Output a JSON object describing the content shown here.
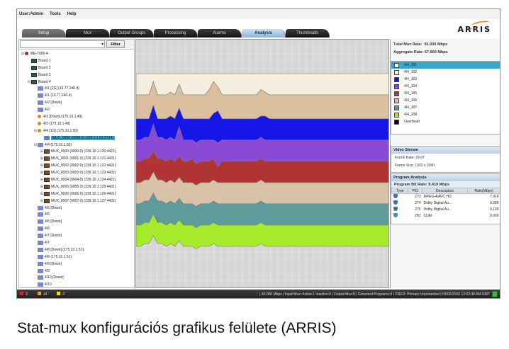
{
  "menu": [
    "User:Admin",
    "Tools",
    "Help"
  ],
  "tabs": [
    "Setup",
    "Mux",
    "Output Groups",
    "Processing",
    "Alarms",
    "Analysis",
    "Thumbnails"
  ],
  "active_tab": "Analysis",
  "logo_text": "ARRIS",
  "filter": {
    "combo_value": "",
    "button_label": "Filter"
  },
  "tree": [
    {
      "indent": 0,
      "exp": "⊟",
      "icon": "dev",
      "text": "ME-7000-4"
    },
    {
      "indent": 1,
      "exp": "",
      "icon": "board",
      "text": "Board 1"
    },
    {
      "indent": 1,
      "exp": "",
      "icon": "board",
      "text": "Board 2"
    },
    {
      "indent": 1,
      "exp": "",
      "icon": "board",
      "text": "Board 3"
    },
    {
      "indent": 1,
      "exp": "⊟",
      "icon": "board",
      "text": "Board 4"
    },
    {
      "indent": 2,
      "exp": "",
      "icon": "out",
      "text": "4/1 [1G] (10.77.240.4)"
    },
    {
      "indent": 2,
      "exp": "",
      "icon": "out",
      "text": "4/1 (10.77.240.4)"
    },
    {
      "indent": 2,
      "exp": "",
      "icon": "out",
      "text": "4/2 [Down]"
    },
    {
      "indent": 2,
      "exp": "",
      "icon": "out",
      "text": "4/2"
    },
    {
      "indent": 2,
      "exp": "",
      "icon": "warn",
      "text": "4/3 [Down] (175.10.1.49)"
    },
    {
      "indent": 2,
      "exp": "",
      "icon": "warn",
      "text": "4/3 (175.10.1.49)"
    },
    {
      "indent": 2,
      "exp": "⊟",
      "icon": "warn",
      "text": "4/4 [1G] (175.10.1.50)"
    },
    {
      "indent": 3,
      "exp": "",
      "icon": "mux",
      "text": "MUX_0000 (0000:0) (239.2.1.91:5724)",
      "selected": true
    },
    {
      "indent": 2,
      "exp": "⊟",
      "icon": "out",
      "text": "4/4 (175.10.1.50)"
    },
    {
      "indent": 3,
      "exp": "⊞",
      "icon": "prog",
      "text": "MUX_0000 (0000:0) (239.10.1.120:4421)"
    },
    {
      "indent": 3,
      "exp": "⊞",
      "icon": "prog",
      "text": "MUX_0001 (0001:0) (239.10.1.121:4421)"
    },
    {
      "indent": 3,
      "exp": "⊞",
      "icon": "prog",
      "text": "MUX_0002 (0002:0) (239.10.1.122:4421)"
    },
    {
      "indent": 3,
      "exp": "⊞",
      "icon": "prog",
      "text": "MUX_0003 (0003:0) (239.10.1.123:4421)"
    },
    {
      "indent": 3,
      "exp": "⊞",
      "icon": "prog",
      "text": "MUX_0004 (0004:0) (239.10.1.124:4421)"
    },
    {
      "indent": 3,
      "exp": "⊞",
      "icon": "prog",
      "text": "MUX_0005 (0005:0) (239.10.1.125:4421)"
    },
    {
      "indent": 3,
      "exp": "⊞",
      "icon": "prog",
      "text": "MUX_0006 (0006:0) (239.10.1.126:4421)"
    },
    {
      "indent": 3,
      "exp": "⊞",
      "icon": "prog",
      "text": "MUX_0007 (0007:0) (239.10.1.127:4421)"
    },
    {
      "indent": 2,
      "exp": "",
      "icon": "out",
      "text": "4/5 [Down]"
    },
    {
      "indent": 2,
      "exp": "",
      "icon": "out",
      "text": "4/5"
    },
    {
      "indent": 2,
      "exp": "",
      "icon": "out",
      "text": "4/6 [Down]"
    },
    {
      "indent": 2,
      "exp": "",
      "icon": "out",
      "text": "4/6"
    },
    {
      "indent": 2,
      "exp": "",
      "icon": "out",
      "text": "4/7 [Down]"
    },
    {
      "indent": 2,
      "exp": "",
      "icon": "out",
      "text": "4/7"
    },
    {
      "indent": 2,
      "exp": "",
      "icon": "out",
      "text": "4/8 [Down] (175.10.1.51)"
    },
    {
      "indent": 2,
      "exp": "",
      "icon": "out",
      "text": "4/8 (175.10.1.51)"
    },
    {
      "indent": 2,
      "exp": "",
      "icon": "out",
      "text": "4/9 [Down]"
    },
    {
      "indent": 2,
      "exp": "",
      "icon": "out",
      "text": "4/9"
    },
    {
      "indent": 2,
      "exp": "",
      "icon": "out",
      "text": "4/10 [Down]"
    },
    {
      "indent": 2,
      "exp": "",
      "icon": "out",
      "text": "4/10"
    }
  ],
  "rates": {
    "total_label": "Total Mux Rate:",
    "total_value": "81.000 Mbps",
    "aggregate_label": "Aggregate Rate:",
    "aggregate_value": "67.860 Mbps"
  },
  "legend": [
    {
      "label": "4/4_101",
      "color": "#ffffff",
      "selected": true
    },
    {
      "label": "4/4_102",
      "color": "#f3eedd"
    },
    {
      "label": "4/4_103",
      "color": "#1616e8"
    },
    {
      "label": "4/4_104",
      "color": "#8a4ad6"
    },
    {
      "label": "4/4_105",
      "color": "#b03434"
    },
    {
      "label": "4/4_106",
      "color": "#dcbf9f"
    },
    {
      "label": "4/4_107",
      "color": "#5e9c9c"
    },
    {
      "label": "4/4_108",
      "color": "#a6ea2c"
    },
    {
      "label": "Overhead",
      "color": "#000000"
    }
  ],
  "video_stream": {
    "header": "Video Stream",
    "frame_rate_label": "Frame Rate:",
    "frame_rate": "29.97",
    "frame_size_label": "Frame Size:",
    "frame_size": "1920 x 1080"
  },
  "program_analysis": {
    "header": "Program Analysis",
    "bit_rate_label": "Program Bit Rate:",
    "bit_rate": "8.419 Mbps",
    "columns": [
      "Type",
      "PID",
      "Description",
      "Rate(Mbps)"
    ],
    "rows": [
      {
        "type": "video-icon",
        "pid": "273",
        "desc": "MPEG-4/AVC HD",
        "rate": "7.919"
      },
      {
        "type": "audio-icon",
        "pid": "274",
        "desc": "Dolby Digital Au...",
        "rate": "0.399"
      },
      {
        "type": "audio-icon",
        "pid": "275",
        "desc": "Dolby Digital Au...",
        "rate": "0.100"
      },
      {
        "type": "data-icon",
        "pid": "281",
        "desc": "CUEI",
        "rate": "0.000"
      }
    ]
  },
  "status": {
    "counts": [
      {
        "color": "#e02020",
        "value": "3"
      },
      {
        "color": "#f0a020",
        "value": "14"
      },
      {
        "color": "#f0e020",
        "value": "2"
      }
    ],
    "text": "| 40.000 Mbps | Input Mux: Active:1 Inactive:0 | Output Mux:8 | Groomed Programs:3 | CRED: Primary:Unprotected | 03/05/2015 12:03:38 AM GMT"
  },
  "caption": "Stat-mux konfigurációs grafikus felülete (ARRIS)",
  "chart_data": {
    "type": "area",
    "stacked": true,
    "series": [
      {
        "name": "4/4_102",
        "color": "#f3eedd",
        "values": [
          8,
          8,
          8,
          8,
          3,
          8,
          8,
          8,
          7,
          8,
          4,
          8,
          8,
          8,
          8,
          8,
          8,
          6,
          3,
          5,
          8,
          8,
          8,
          8,
          8,
          8,
          8,
          8,
          8,
          6,
          7,
          8,
          8,
          8,
          8,
          8,
          8,
          8,
          8,
          8,
          8,
          8,
          8,
          8,
          8,
          8,
          8,
          8,
          8,
          8,
          8,
          8,
          8,
          8,
          8,
          8,
          8,
          8,
          8,
          8
        ]
      },
      {
        "name": "4/4_106",
        "color": "#dcbf9f",
        "values": [
          9,
          9,
          9,
          9,
          9,
          9,
          9,
          9,
          9,
          9,
          9,
          9,
          9,
          9,
          9,
          9,
          9,
          11,
          12,
          9,
          9,
          9,
          9,
          9,
          9,
          9,
          9,
          9,
          9,
          10,
          9,
          9,
          9,
          9,
          9,
          9,
          9,
          9,
          9,
          9,
          9,
          9,
          9,
          9,
          9,
          9,
          9,
          9,
          9,
          9,
          9,
          9,
          9,
          9,
          9,
          9,
          9,
          9,
          9,
          9
        ]
      },
      {
        "name": "4/4_103",
        "color": "#1616e8",
        "values": [
          8,
          8,
          7,
          7,
          7,
          7,
          7,
          8,
          8,
          8,
          7,
          8,
          8,
          8,
          9,
          8,
          8,
          8,
          10,
          12,
          8,
          8,
          8,
          8,
          8,
          8,
          8,
          8,
          8,
          8,
          9,
          8,
          8,
          8,
          8,
          8,
          8,
          8,
          8,
          8,
          8,
          8,
          8,
          8,
          8,
          8,
          8,
          8,
          8,
          8,
          8,
          8,
          8,
          8,
          8,
          8,
          8,
          8,
          8,
          8
        ]
      },
      {
        "name": "4/4_104",
        "color": "#8a4ad6",
        "values": [
          8,
          8,
          8,
          8,
          10,
          8,
          8,
          8,
          8,
          8,
          11,
          8,
          8,
          7,
          8,
          8,
          8,
          8,
          7,
          9,
          8,
          8,
          8,
          8,
          8,
          8,
          8,
          8,
          8,
          8,
          8,
          8,
          8,
          8,
          8,
          8,
          8,
          8,
          8,
          8,
          8,
          8,
          8,
          8,
          8,
          8,
          8,
          8,
          8,
          8,
          8,
          8,
          8,
          8,
          8,
          8,
          8,
          8,
          8,
          8
        ]
      },
      {
        "name": "4/4_105",
        "color": "#b03434",
        "values": [
          8,
          8,
          8,
          8,
          8,
          8,
          8,
          8,
          8,
          8,
          8,
          8,
          8,
          9,
          8,
          8,
          8,
          8,
          8,
          6,
          8,
          8,
          8,
          8,
          8,
          8,
          8,
          8,
          8,
          8,
          8,
          8,
          8,
          8,
          8,
          8,
          8,
          8,
          8,
          8,
          8,
          8,
          8,
          8,
          8,
          8,
          8,
          8,
          8,
          8,
          8,
          8,
          8,
          8,
          8,
          8,
          8,
          8,
          8,
          8
        ]
      },
      {
        "name": "4/4_101",
        "color": "#d8c2a8",
        "values": [
          8,
          8,
          8,
          8,
          8,
          8,
          8,
          8,
          8,
          8,
          8,
          8,
          8,
          8,
          8,
          8,
          8,
          8,
          8,
          8,
          8,
          8,
          8,
          8,
          8,
          8,
          8,
          8,
          8,
          8,
          8,
          8,
          8,
          8,
          8,
          8,
          8,
          8,
          8,
          8,
          8,
          8,
          8,
          8,
          8,
          8,
          8,
          8,
          8,
          8,
          8,
          8,
          8,
          8,
          8,
          8,
          8,
          8,
          8,
          8
        ]
      },
      {
        "name": "4/4_107",
        "color": "#5e9c9c",
        "values": [
          8,
          8,
          8,
          8,
          8,
          8,
          8,
          8,
          8,
          8,
          8,
          8,
          8,
          8,
          8,
          8,
          8,
          8,
          8,
          8,
          8,
          8,
          8,
          8,
          8,
          8,
          8,
          8,
          8,
          8,
          8,
          8,
          8,
          8,
          8,
          8,
          8,
          8,
          8,
          8,
          8,
          8,
          8,
          8,
          8,
          8,
          8,
          8,
          8,
          8,
          8,
          8,
          8,
          8,
          8,
          8,
          8,
          8,
          8,
          8
        ]
      },
      {
        "name": "4/4_108",
        "color": "#a6ea2c",
        "values": [
          8,
          8,
          8,
          8,
          8,
          8,
          8,
          8,
          8,
          8,
          8,
          8,
          8,
          8,
          8,
          8,
          8,
          8,
          8,
          8,
          8,
          8,
          8,
          8,
          8,
          8,
          8,
          8,
          8,
          8,
          8,
          8,
          8,
          8,
          8,
          8,
          8,
          8,
          8,
          8,
          8,
          8,
          8,
          8,
          8,
          8,
          8,
          8,
          8,
          8,
          8,
          8,
          8,
          8,
          8,
          8,
          8,
          8,
          8,
          8
        ]
      }
    ],
    "ylim": [
      0,
      81
    ],
    "grid": true
  }
}
